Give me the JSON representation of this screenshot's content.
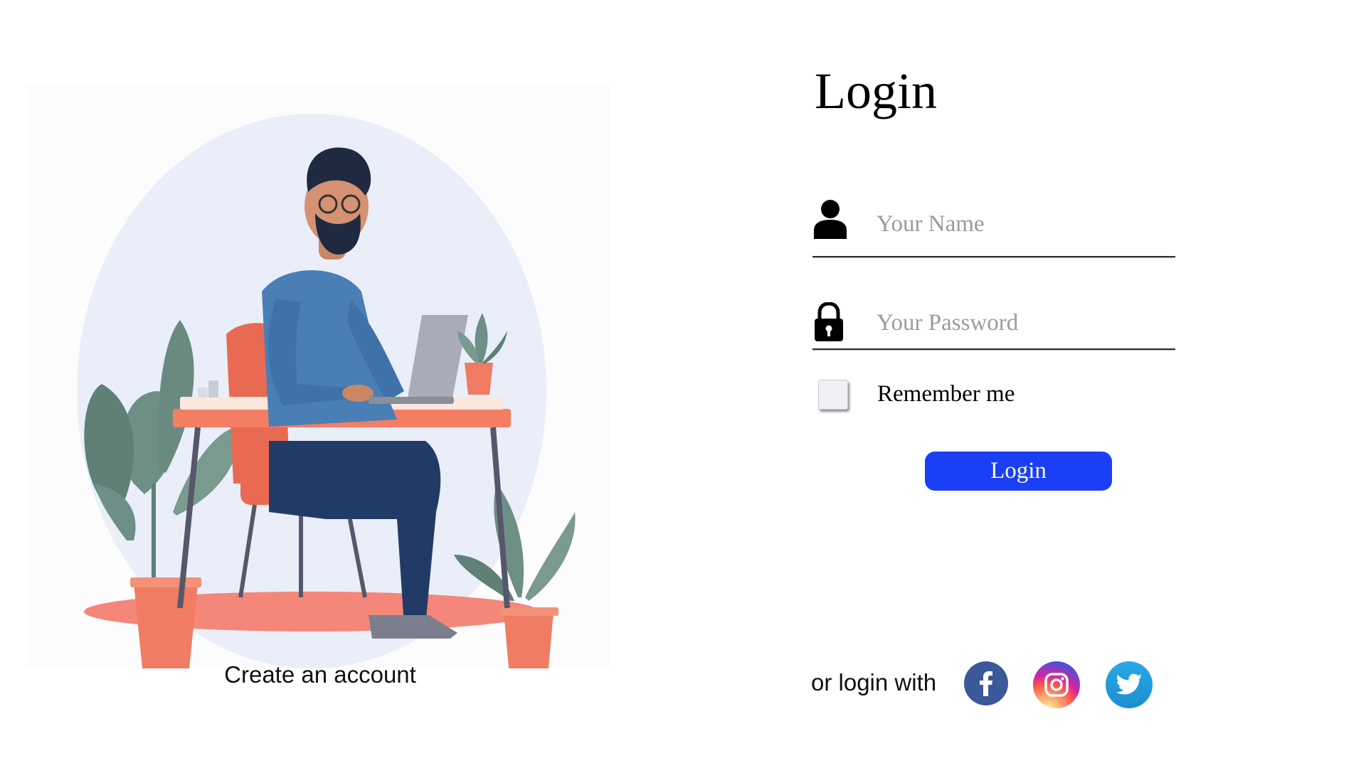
{
  "login": {
    "title": "Login",
    "name_placeholder": "Your Name",
    "password_placeholder": "Your Password",
    "remember_label": "Remember me",
    "remember_checked": false,
    "button_label": "Login",
    "button_color": "#1a3ff5"
  },
  "create_account": {
    "label": "Create an account"
  },
  "social": {
    "prompt": "or login with",
    "providers": [
      {
        "name": "facebook",
        "icon": "facebook-icon",
        "color": "#3b5998"
      },
      {
        "name": "instagram",
        "icon": "instagram-icon",
        "color": "#d6249f"
      },
      {
        "name": "twitter",
        "icon": "twitter-icon",
        "color": "#1da1f2"
      }
    ]
  },
  "illustration": {
    "icon": "person-at-desk-illustration"
  },
  "icons": {
    "name_field": "user-icon",
    "password_field": "lock-icon"
  }
}
